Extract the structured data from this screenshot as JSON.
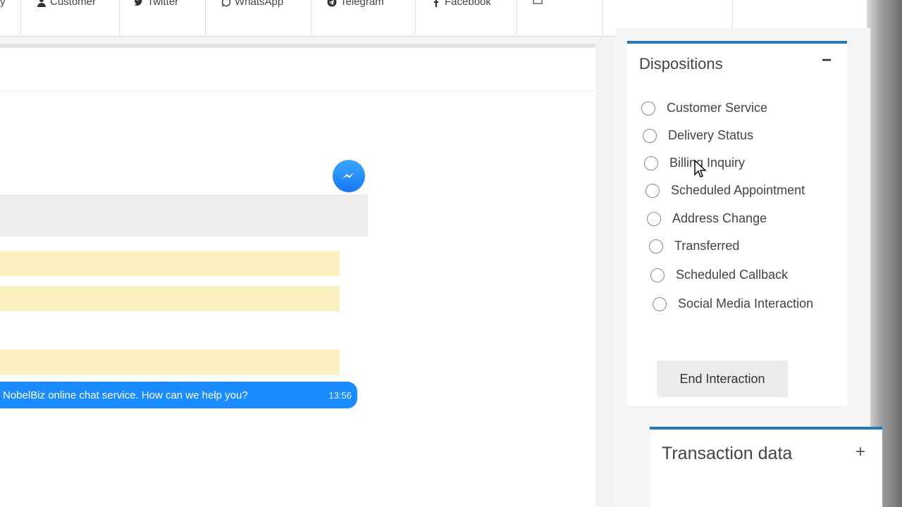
{
  "tabs": [
    {
      "label": "y",
      "icon": "none"
    },
    {
      "label": "Customer",
      "icon": "user-icon"
    },
    {
      "label": "Twitter",
      "icon": "twitter-icon"
    },
    {
      "label": "WhatsApp",
      "icon": "whatsapp-icon"
    },
    {
      "label": "Telegram",
      "icon": "telegram-icon"
    },
    {
      "label": "Facebook",
      "icon": "facebook-icon"
    },
    {
      "label": "",
      "icon": "tab-icon"
    }
  ],
  "chat": {
    "message_text": "NobelBiz online chat service. How can we help you?",
    "message_time": "13:56",
    "bubble_color": "#1a8cff",
    "channel_icon": "messenger-icon"
  },
  "dispositions": {
    "title": "Dispositions",
    "collapse_label": "−",
    "options": [
      "Customer Service",
      "Delivery Status",
      "Billing Inquiry",
      "Scheduled Appointment",
      "Address Change",
      "Transferred",
      "Scheduled Callback",
      "Social Media Interaction"
    ],
    "end_button": "End Interaction"
  },
  "transaction": {
    "title": "Transaction data",
    "expand_label": "+"
  },
  "colors": {
    "accent": "#2b78b8",
    "highlight_yellow": "#fdf0c2"
  }
}
